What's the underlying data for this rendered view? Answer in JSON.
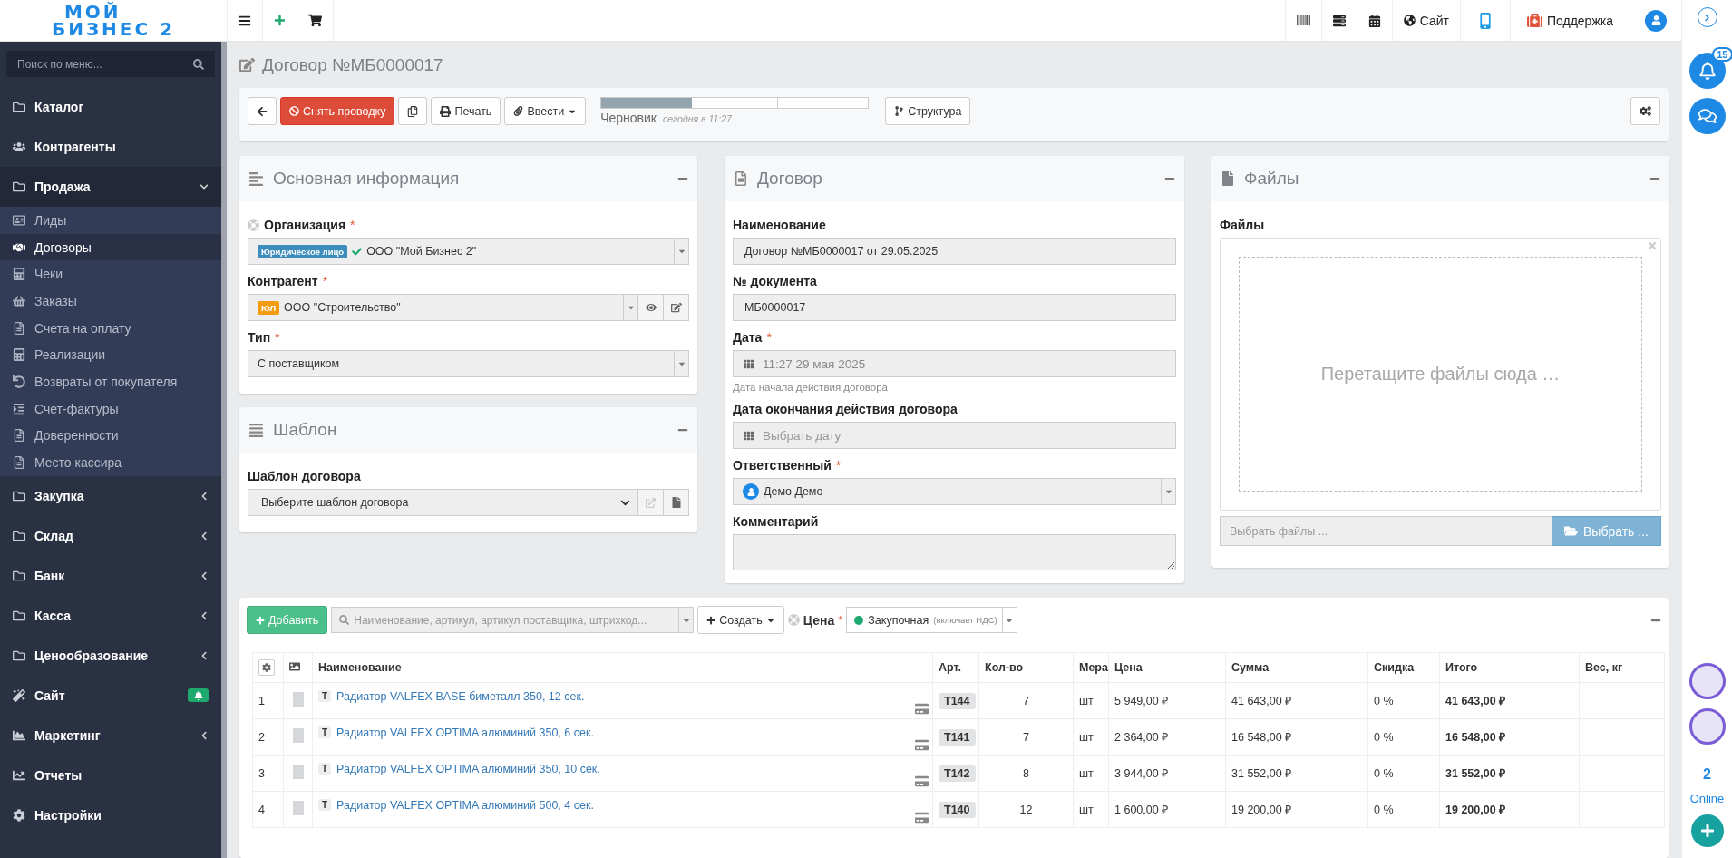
{
  "logo": {
    "line1": "МОЙ",
    "line2": "БИЗНЕС 2"
  },
  "topbar": {
    "site": "Сайт",
    "support": "Поддержка"
  },
  "sidebar": {
    "search_placeholder": "Поиск по меню...",
    "items": [
      {
        "label": "Каталог"
      },
      {
        "label": "Контрагенты"
      },
      {
        "label": "Продажа",
        "expanded": true,
        "children": [
          {
            "label": "Лиды",
            "selected": false
          },
          {
            "label": "Договоры",
            "selected": true
          },
          {
            "label": "Чеки",
            "selected": false
          },
          {
            "label": "Заказы",
            "selected": false
          },
          {
            "label": "Счета на оплату",
            "selected": false
          },
          {
            "label": "Реализации",
            "selected": false
          },
          {
            "label": "Возвраты от покупателя",
            "selected": false
          },
          {
            "label": "Счет-фактуры",
            "selected": false
          },
          {
            "label": "Доверенности",
            "selected": false
          },
          {
            "label": "Место кассира",
            "selected": false
          }
        ]
      },
      {
        "label": "Закупка",
        "expanded": false
      },
      {
        "label": "Склад",
        "expanded": false
      },
      {
        "label": "Банк",
        "expanded": false
      },
      {
        "label": "Касса",
        "expanded": false
      },
      {
        "label": "Ценообразование",
        "expanded": false
      },
      {
        "label": "Сайт",
        "notification": true
      },
      {
        "label": "Маркетинг",
        "expanded": false
      },
      {
        "label": "Отчеты"
      },
      {
        "label": "Настройки"
      }
    ]
  },
  "page_title": "Договор №МБ0000017",
  "toolbar": {
    "unpost": "Снять проводку",
    "print": "Печать",
    "enter": "Ввести",
    "structure": "Структура",
    "status": {
      "level": 0.34,
      "label": "Черновик",
      "time": "сегодня в 11:27"
    }
  },
  "main_info": {
    "title": "Основная информация",
    "fields": [
      {
        "kind": "select",
        "label": "Организация",
        "required": "*",
        "shared": true,
        "badge": {
          "text": "Юридическое лицо",
          "color": "#3c8dbc"
        },
        "verified": true,
        "value": "ООО \"Мой Бизнес 2\""
      },
      {
        "kind": "select_actions",
        "label": "Контрагент",
        "required": "*",
        "badge": {
          "text": "ЮЛ",
          "color": "#f39c12"
        },
        "value": "ООО \"Строительство\""
      },
      {
        "kind": "select",
        "label": "Тип",
        "required": "*",
        "value": "С поставщиком"
      }
    ]
  },
  "template": {
    "title": "Шаблон",
    "fields": [
      {
        "kind": "native_select",
        "label": "Шаблон договора",
        "value": "Выберите шаблон договора"
      }
    ]
  },
  "contract": {
    "title": "Договор",
    "fields": [
      {
        "kind": "input",
        "label": "Наименование",
        "value": "Договор №МБ0000017 от 29.05.2025"
      },
      {
        "kind": "input",
        "label": "№ документа",
        "value": "МБ0000017"
      },
      {
        "kind": "date",
        "label": "Дата",
        "required": "*",
        "value": "11:27 29 мая 2025",
        "hint": "Дата начала действия договора"
      },
      {
        "kind": "date",
        "label": "Дата окончания действия договора",
        "placeholder": "Выбрать дату"
      },
      {
        "kind": "user",
        "label": "Ответственный",
        "required": "*",
        "value": "Демо Демо"
      },
      {
        "kind": "textarea",
        "label": "Комментарий"
      }
    ]
  },
  "files": {
    "title": "Файлы",
    "label": "Файлы",
    "drop_text": "Перетащите файлы сюда …",
    "input_placeholder": "Выбрать файлы ...",
    "browse": "Выбрать ..."
  },
  "items": {
    "add": "Добавить",
    "search_placeholder": "Наименование, артикул, артикул поставщика, штрихкод...",
    "create": "Создать",
    "price_label": "Цена",
    "price_required": "*",
    "price_value": "Закупочная",
    "price_note": "(включает НДС)",
    "columns": [
      "Наименование",
      "Арт.",
      "Кол-во",
      "Мера",
      "Цена",
      "Сумма",
      "Скидка",
      "Итого",
      "Вес, кг"
    ],
    "rows": [
      {
        "num": "1",
        "type": "Т",
        "name": "Радиатор VALFEX BASE биметалл 350, 12 сек.",
        "sku": "T144",
        "qty": "7",
        "unit": "шт",
        "price": "5 949,00 ₽",
        "sum": "41 643,00 ₽",
        "discount": "0 %",
        "total": "41 643,00 ₽"
      },
      {
        "num": "2",
        "type": "Т",
        "name": "Радиатор VALFEX OPTIMA алюминий 350, 6 сек.",
        "sku": "T141",
        "qty": "7",
        "unit": "шт",
        "price": "2 364,00 ₽",
        "sum": "16 548,00 ₽",
        "discount": "0 %",
        "total": "16 548,00 ₽"
      },
      {
        "num": "3",
        "type": "Т",
        "name": "Радиатор VALFEX OPTIMA алюминий 350, 10 сек.",
        "sku": "T142",
        "qty": "8",
        "unit": "шт",
        "price": "3 944,00 ₽",
        "sum": "31 552,00 ₽",
        "discount": "0 %",
        "total": "31 552,00 ₽"
      },
      {
        "num": "4",
        "type": "Т",
        "name": "Радиатор VALFEX OPTIMA алюминий 500, 4 сек.",
        "sku": "T140",
        "qty": "12",
        "unit": "шт",
        "price": "1 600,00 ₽",
        "sum": "19 200,00 ₽",
        "discount": "0 %",
        "total": "19 200,00 ₽"
      }
    ]
  },
  "rail": {
    "notifications": "15",
    "online_count": "2",
    "online_label": "Online"
  }
}
